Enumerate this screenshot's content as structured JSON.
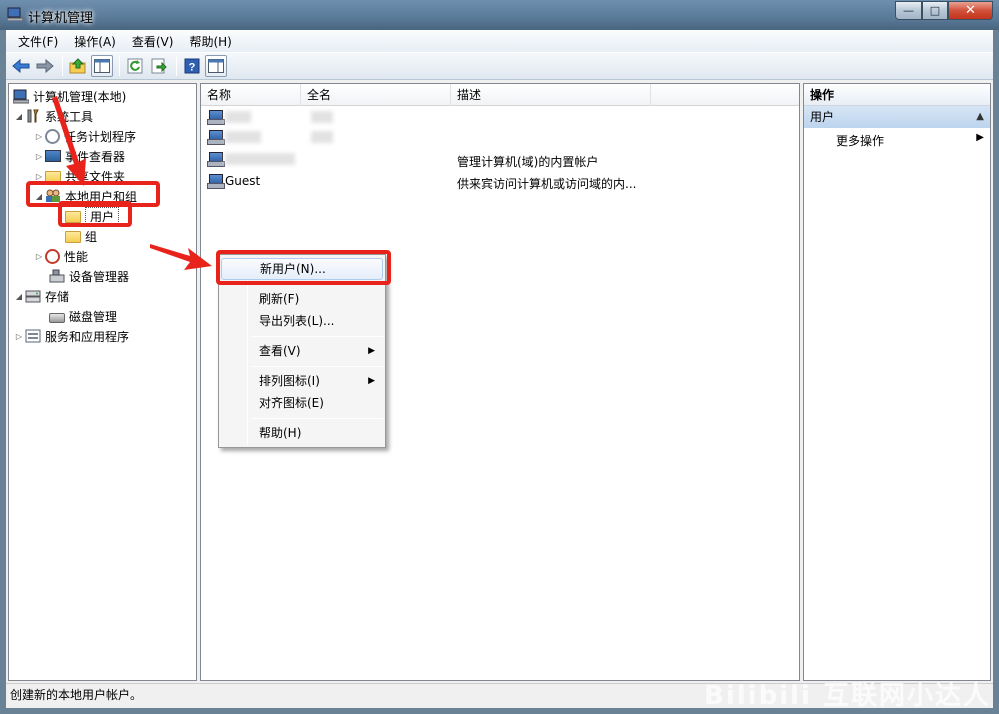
{
  "window": {
    "title": "计算机管理",
    "minimize": "—",
    "maximize": "□",
    "close": "✕"
  },
  "menubar": [
    "文件(F)",
    "操作(A)",
    "查看(V)",
    "帮助(H)"
  ],
  "toolbar": [
    "back-icon",
    "forward-icon",
    "up-folder-icon",
    "show-hide-tree-icon",
    "refresh-icon",
    "export-icon",
    "help-icon",
    "properties-icon"
  ],
  "tree": {
    "root": "计算机管理(本地)",
    "system_tools": "系统工具",
    "task_scheduler": "任务计划程序",
    "event_viewer": "事件查看器",
    "shared_folders": "共享文件夹",
    "local_users_groups": "本地用户和组",
    "users": "用户",
    "groups": "组",
    "performance": "性能",
    "device_manager": "设备管理器",
    "storage": "存储",
    "disk_management": "磁盘管理",
    "services_apps": "服务和应用程序"
  },
  "list": {
    "columns": [
      "名称",
      "全名",
      "描述"
    ],
    "rows": [
      {
        "name": "",
        "full": "",
        "desc": ""
      },
      {
        "name": "",
        "full": "",
        "desc": ""
      },
      {
        "name": "",
        "full": "",
        "desc": "管理计算机(域)的内置帐户"
      },
      {
        "name": "Guest",
        "full": "",
        "desc": "供来宾访问计算机或访问域的内..."
      }
    ]
  },
  "actions": {
    "header": "操作",
    "section": "用户",
    "more": "更多操作"
  },
  "context_menu": {
    "new_user": "新用户(N)...",
    "refresh": "刷新(F)",
    "export": "导出列表(L)...",
    "view": "查看(V)",
    "arrange": "排列图标(I)",
    "align": "对齐图标(E)",
    "help": "帮助(H)"
  },
  "status": "创建新的本地用户帐户。",
  "watermark": "Bilibili 互联网小达人",
  "colors": {
    "annotation": "#e8231b",
    "selection": "#bcd4ee"
  }
}
